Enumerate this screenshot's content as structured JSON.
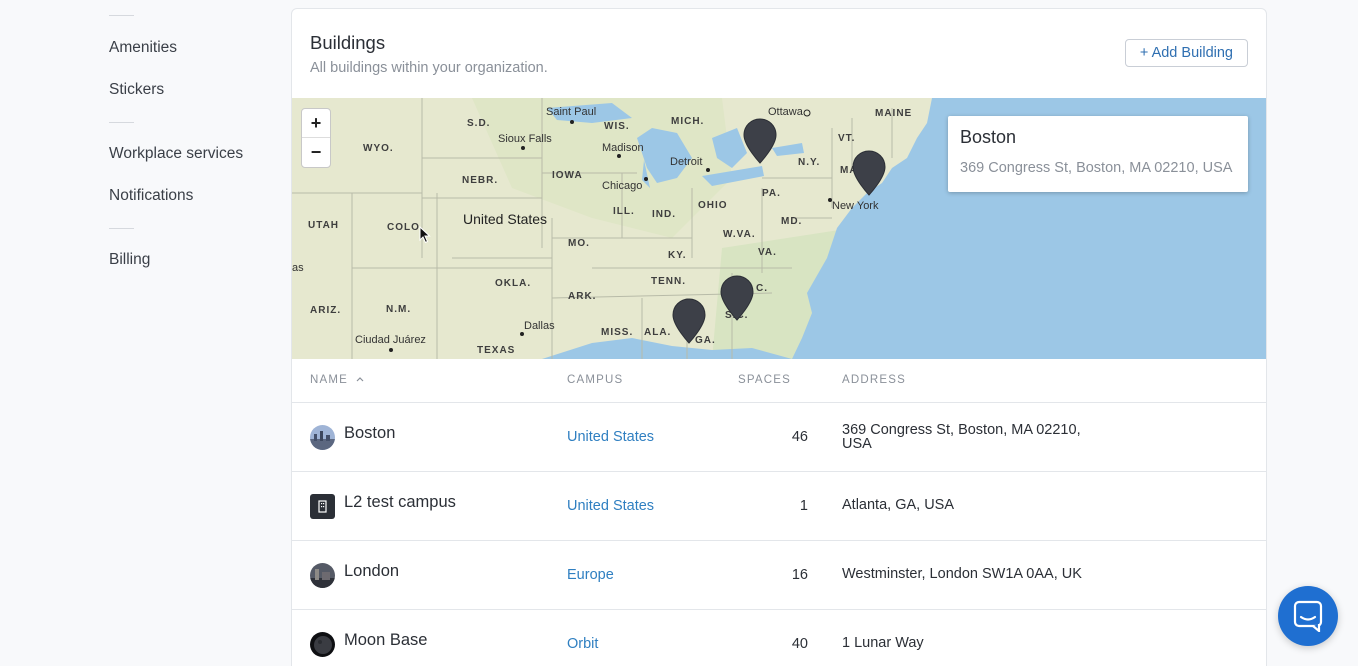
{
  "sidebar": {
    "items": [
      {
        "label": "Amenities"
      },
      {
        "label": "Stickers"
      },
      {
        "label": "Workplace services"
      },
      {
        "label": "Notifications"
      },
      {
        "label": "Billing"
      }
    ]
  },
  "card": {
    "title": "Buildings",
    "subtitle": "All buildings within your organization.",
    "add_button": "+ Add Building"
  },
  "map": {
    "zoom_in": "+",
    "zoom_out": "−",
    "country_label": "United States",
    "state_labels": [
      "S.D.",
      "WYO.",
      "NEBR.",
      "UTAH",
      "COLO.",
      "OKLA.",
      "ARIZ.",
      "N.M.",
      "TEXAS",
      "IOWA",
      "WIS.",
      "MICH.",
      "ILL.",
      "IND.",
      "OHIO",
      "MO.",
      "KY.",
      "W.VA.",
      "VA.",
      "TENN.",
      "ARK.",
      "MISS.",
      "ALA.",
      "GA.",
      "S.C.",
      "PA.",
      "MD.",
      "N.Y.",
      "VT.",
      "MAINE",
      "MA",
      "C."
    ],
    "city_labels": [
      "Saint Paul",
      "Sioux Falls",
      "Madison",
      "Detroit",
      "Chicago",
      "Ottawa",
      "New York",
      "Dallas",
      "Ciudad Juárez",
      "as"
    ],
    "popup": {
      "title": "Boston",
      "address": "369 Congress St, Boston, MA 02210, USA"
    },
    "colors": {
      "water": "#9cc7e6",
      "land": "#e6e8cf"
    }
  },
  "table": {
    "headers": {
      "name": "NAME",
      "campus": "CAMPUS",
      "spaces": "SPACES",
      "address": "ADDRESS"
    },
    "rows": [
      {
        "name": "Boston",
        "campus": "United States",
        "spaces": "46",
        "address": "369 Congress St, Boston, MA 02210, USA",
        "avatar": "city-photo"
      },
      {
        "name": "L2 test campus",
        "campus": "United States",
        "spaces": "1",
        "address": "Atlanta, GA, USA",
        "avatar": "building-icon"
      },
      {
        "name": "London",
        "campus": "Europe",
        "spaces": "16",
        "address": "Westminster, London SW1A 0AA, UK",
        "avatar": "city-photo"
      },
      {
        "name": "Moon Base",
        "campus": "Orbit",
        "spaces": "40",
        "address": "1 Lunar Way",
        "avatar": "moon-photo"
      }
    ]
  },
  "chat": {
    "icon": "chat-icon",
    "color": "#1f6fd1"
  }
}
